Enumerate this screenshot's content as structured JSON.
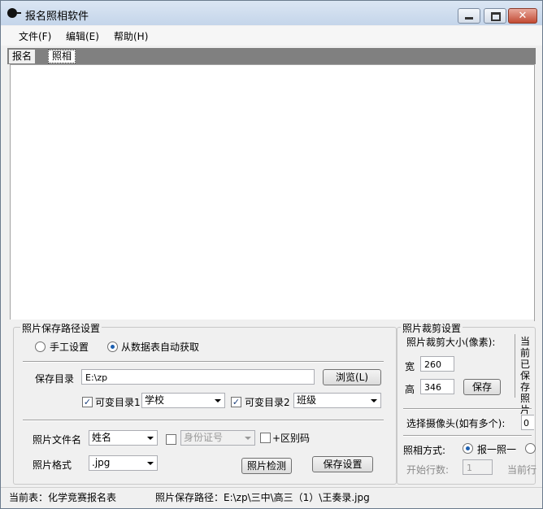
{
  "window": {
    "title": "报名照相软件"
  },
  "menu": {
    "file": "文件(F)",
    "edit": "编辑(E)",
    "help": "帮助(H)"
  },
  "tabs": {
    "signup": "报名",
    "photo": "照相"
  },
  "save_path_group": {
    "legend": "照片保存路径设置",
    "manual_label": "手工设置",
    "auto_label": "从数据表自动获取",
    "dir_label": "保存目录",
    "dir_value": "E:\\zp",
    "browse_label": "浏览(L)",
    "var_dir1_label": "可变目录1",
    "var_dir1_value": "学校",
    "var_dir2_label": "可变目录2",
    "var_dir2_value": "班级",
    "filename_label": "照片文件名",
    "filename_value": "姓名",
    "id_value": "身份证号",
    "distinguish_label": "+区别码",
    "format_label": "照片格式",
    "format_value": ".jpg",
    "detect_label": "照片检测",
    "save_settings_label": "保存设置"
  },
  "crop_group": {
    "legend": "照片裁剪设置",
    "size_label": "照片裁剪大小(像素):",
    "width_label": "宽",
    "width_value": "260",
    "height_label": "高",
    "height_value": "346",
    "save_label": "保存",
    "side_text": "当前已保存照片",
    "camera_label": "选择摄像头(如有多个):",
    "camera_value": "0",
    "method_label": "照相方式:",
    "method_option": "报一照一",
    "start_row_label": "开始行数:",
    "start_row_value": "1",
    "current_row_label": "当前行"
  },
  "status": {
    "current_table": "当前表：化学竞赛报名表",
    "photo_path": "照片保存路径：E:\\zp\\三中\\高三（1）\\王奏录.jpg"
  }
}
